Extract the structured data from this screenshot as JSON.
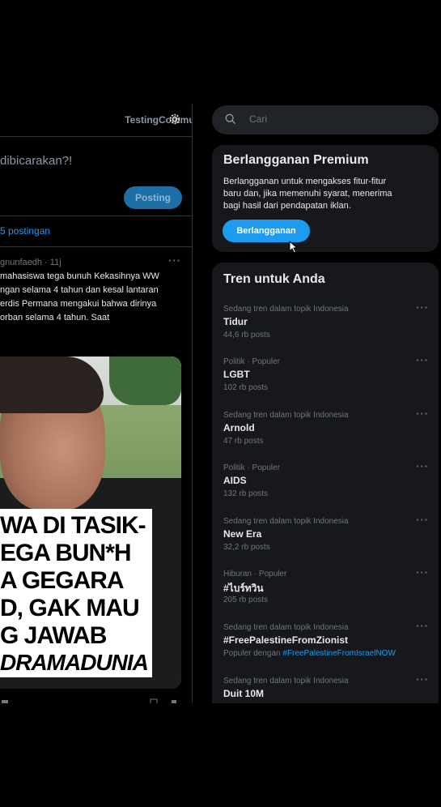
{
  "community": {
    "name": "TestingCommunity"
  },
  "compose": {
    "placeholder": "dibicarakan?!",
    "post_label": "Posting"
  },
  "feed": {
    "show_posts": "5 postingan",
    "tweet": {
      "meta": "gnunfaedh · 11j",
      "more": "···",
      "lines": [
        "mahasiswa tega bunuh Kekasihnya WW",
        "ngan selama 4 tahun dan kesal lantaran",
        "erdis Permana mengakui bahwa dirinya",
        "orban selama 4 tahun. Saat"
      ],
      "image_caption": [
        "WA DI TASIK-",
        "EGA BUN*H",
        "A GEGARA",
        "D, GAK MAU",
        "G JAWAB",
        "DRAMADUNIA"
      ]
    }
  },
  "search": {
    "placeholder": "Cari",
    "icon": "search-icon"
  },
  "premium": {
    "title": "Berlangganan Premium",
    "desc": [
      "Berlangganan untuk mengakses fitur-fitur",
      "baru dan, jika memenuhi syarat, menerima",
      "bagi hasil dari pendapatan iklan."
    ],
    "button": "Berlangganan"
  },
  "trends": {
    "title": "Tren untuk Anda",
    "more": "···",
    "items": [
      {
        "context": "Sedang tren dalam topik Indonesia",
        "name": "Tidur",
        "count": "44,6 rb posts"
      },
      {
        "context": "Politik · Populer",
        "name": "LGBT",
        "count": "102 rb posts"
      },
      {
        "context": "Sedang tren dalam topik Indonesia",
        "name": "Arnold",
        "count": "47 rb posts"
      },
      {
        "context": "Politik · Populer",
        "name": "AIDS",
        "count": "132 rb posts"
      },
      {
        "context": "Sedang tren dalam topik Indonesia",
        "name": "New Era",
        "count": "32,2 rb posts"
      },
      {
        "context": "Hiburan · Populer",
        "name": "#ไบร์ทวิน",
        "count": "205 rb posts"
      },
      {
        "context": "Sedang tren dalam topik Indonesia",
        "name": "#FreePalestineFromZionist",
        "count_prefix": "Populer dengan ",
        "count_tag": "#FreePalestineFromIsraelNOW"
      },
      {
        "context": "Sedang tren dalam topik Indonesia",
        "name": "Duit 10M"
      }
    ]
  },
  "colors": {
    "accent": "#1d9bf0",
    "card_bg": "#16181c",
    "page_bg": "#000000"
  }
}
